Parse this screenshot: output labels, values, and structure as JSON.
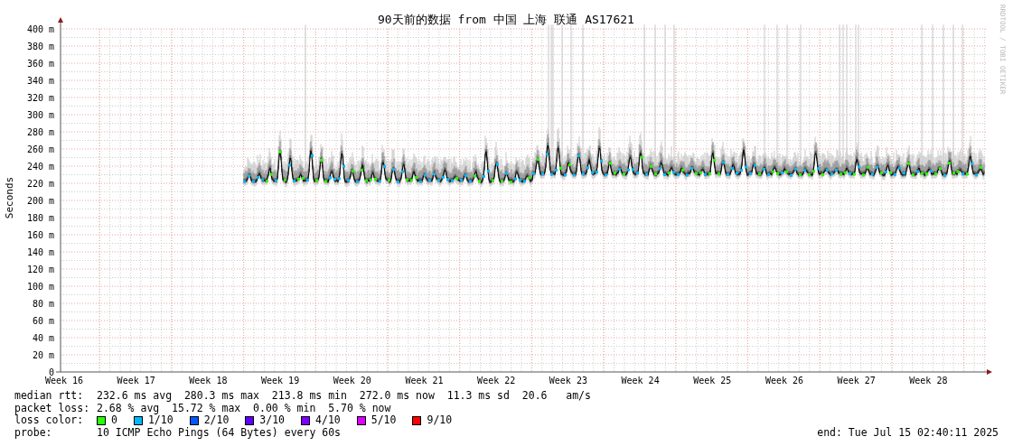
{
  "title": "90天前的数据 from 中国 上海 联通 AS17621",
  "y_axis": {
    "label": "Seconds",
    "ticks": [
      "400 m",
      "380 m",
      "360 m",
      "340 m",
      "320 m",
      "300 m",
      "280 m",
      "260 m",
      "240 m",
      "220 m",
      "200 m",
      "180 m",
      "160 m",
      "140 m",
      "120 m",
      "100 m",
      "80 m",
      "60 m",
      "40 m",
      "20 m",
      "0"
    ]
  },
  "x_axis": {
    "ticks": [
      "Week 16",
      "Week 17",
      "Week 18",
      "Week 19",
      "Week 20",
      "Week 21",
      "Week 22",
      "Week 23",
      "Week 24",
      "Week 25",
      "Week 26",
      "Week 27",
      "Week 28"
    ]
  },
  "credit": "RRDTOOL / TOBI OETIKER",
  "stats": [
    {
      "label": "median rtt:",
      "text": "232.6 ms avg  280.3 ms max  213.8 ms min  272.0 ms now  11.3 ms sd  20.6   am/s"
    },
    {
      "label": "packet loss:",
      "text": "2.68 % avg  15.72 % max  0.00 % min  5.70 % now"
    }
  ],
  "loss_color": {
    "label": "loss color:",
    "items": [
      {
        "label": "0",
        "color": "#26ff00"
      },
      {
        "label": "1/10",
        "color": "#00b8ff"
      },
      {
        "label": "2/10",
        "color": "#0059ff"
      },
      {
        "label": "3/10",
        "color": "#5e00ff"
      },
      {
        "label": "4/10",
        "color": "#7e00ff"
      },
      {
        "label": "5/10",
        "color": "#dd00ff"
      },
      {
        "label": "9/10",
        "color": "#ff0000"
      }
    ]
  },
  "probe": {
    "label": "probe:",
    "text": "10 ICMP Echo Pings (64 Bytes) every 60s"
  },
  "end": "end: Tue Jul 15 02:40:11 2025"
}
